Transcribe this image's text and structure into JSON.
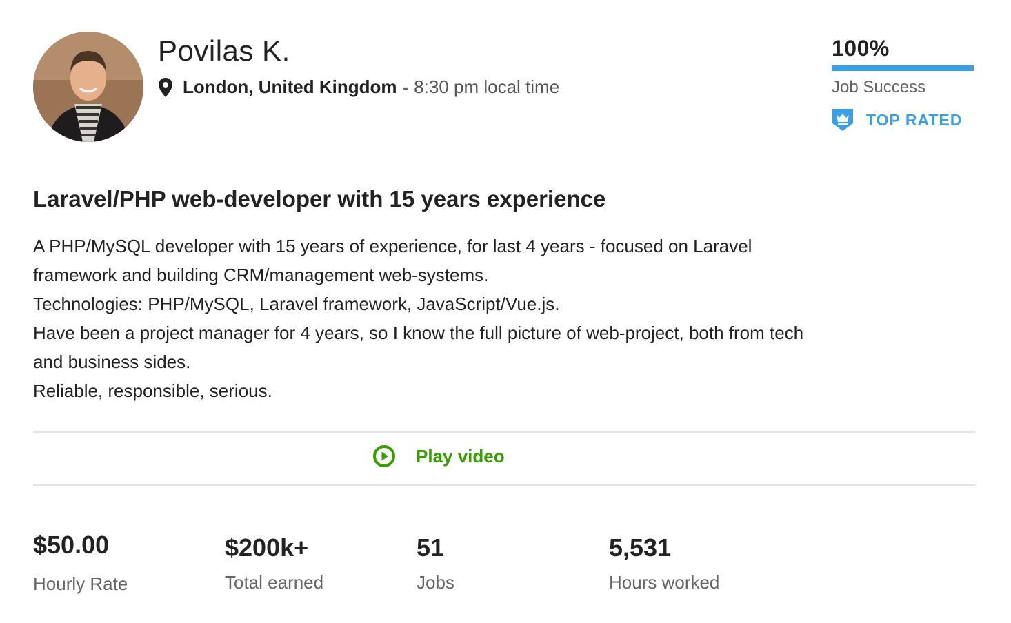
{
  "profile": {
    "name": "Povilas K.",
    "location": "London, United Kingdom",
    "separator": "-",
    "local_time": "8:30 pm local time"
  },
  "job_success": {
    "percent_text": "100%",
    "fill_fraction": 1.0,
    "label": "Job Success",
    "badge": "TOP RATED"
  },
  "overview": {
    "title": "Laravel/PHP web-developer with 15 years experience",
    "lines": [
      "A PHP/MySQL developer with 15 years of experience, for last 4 years - focused on Laravel",
      "framework and building CRM/management web-systems.",
      "Technologies: PHP/MySQL, Laravel framework, JavaScript/Vue.js.",
      "Have been a project manager for 4 years, so I know the full picture of web-project, both from tech",
      "and business sides.",
      "Reliable, responsible, serious."
    ]
  },
  "video": {
    "label": "Play video"
  },
  "stats": [
    {
      "value": "$50.00",
      "label": "Hourly Rate"
    },
    {
      "value": "$200k+",
      "label": "Total earned"
    },
    {
      "value": "51",
      "label": "Jobs"
    },
    {
      "value": "5,531",
      "label": "Hours worked"
    }
  ],
  "icons": {
    "location": "map-pin-icon",
    "badge": "top-rated-crown-badge-icon",
    "play": "play-circle-icon"
  },
  "colors": {
    "accent_blue": "#37a0e6",
    "accent_green": "#37a000",
    "muted_text": "#656565"
  }
}
